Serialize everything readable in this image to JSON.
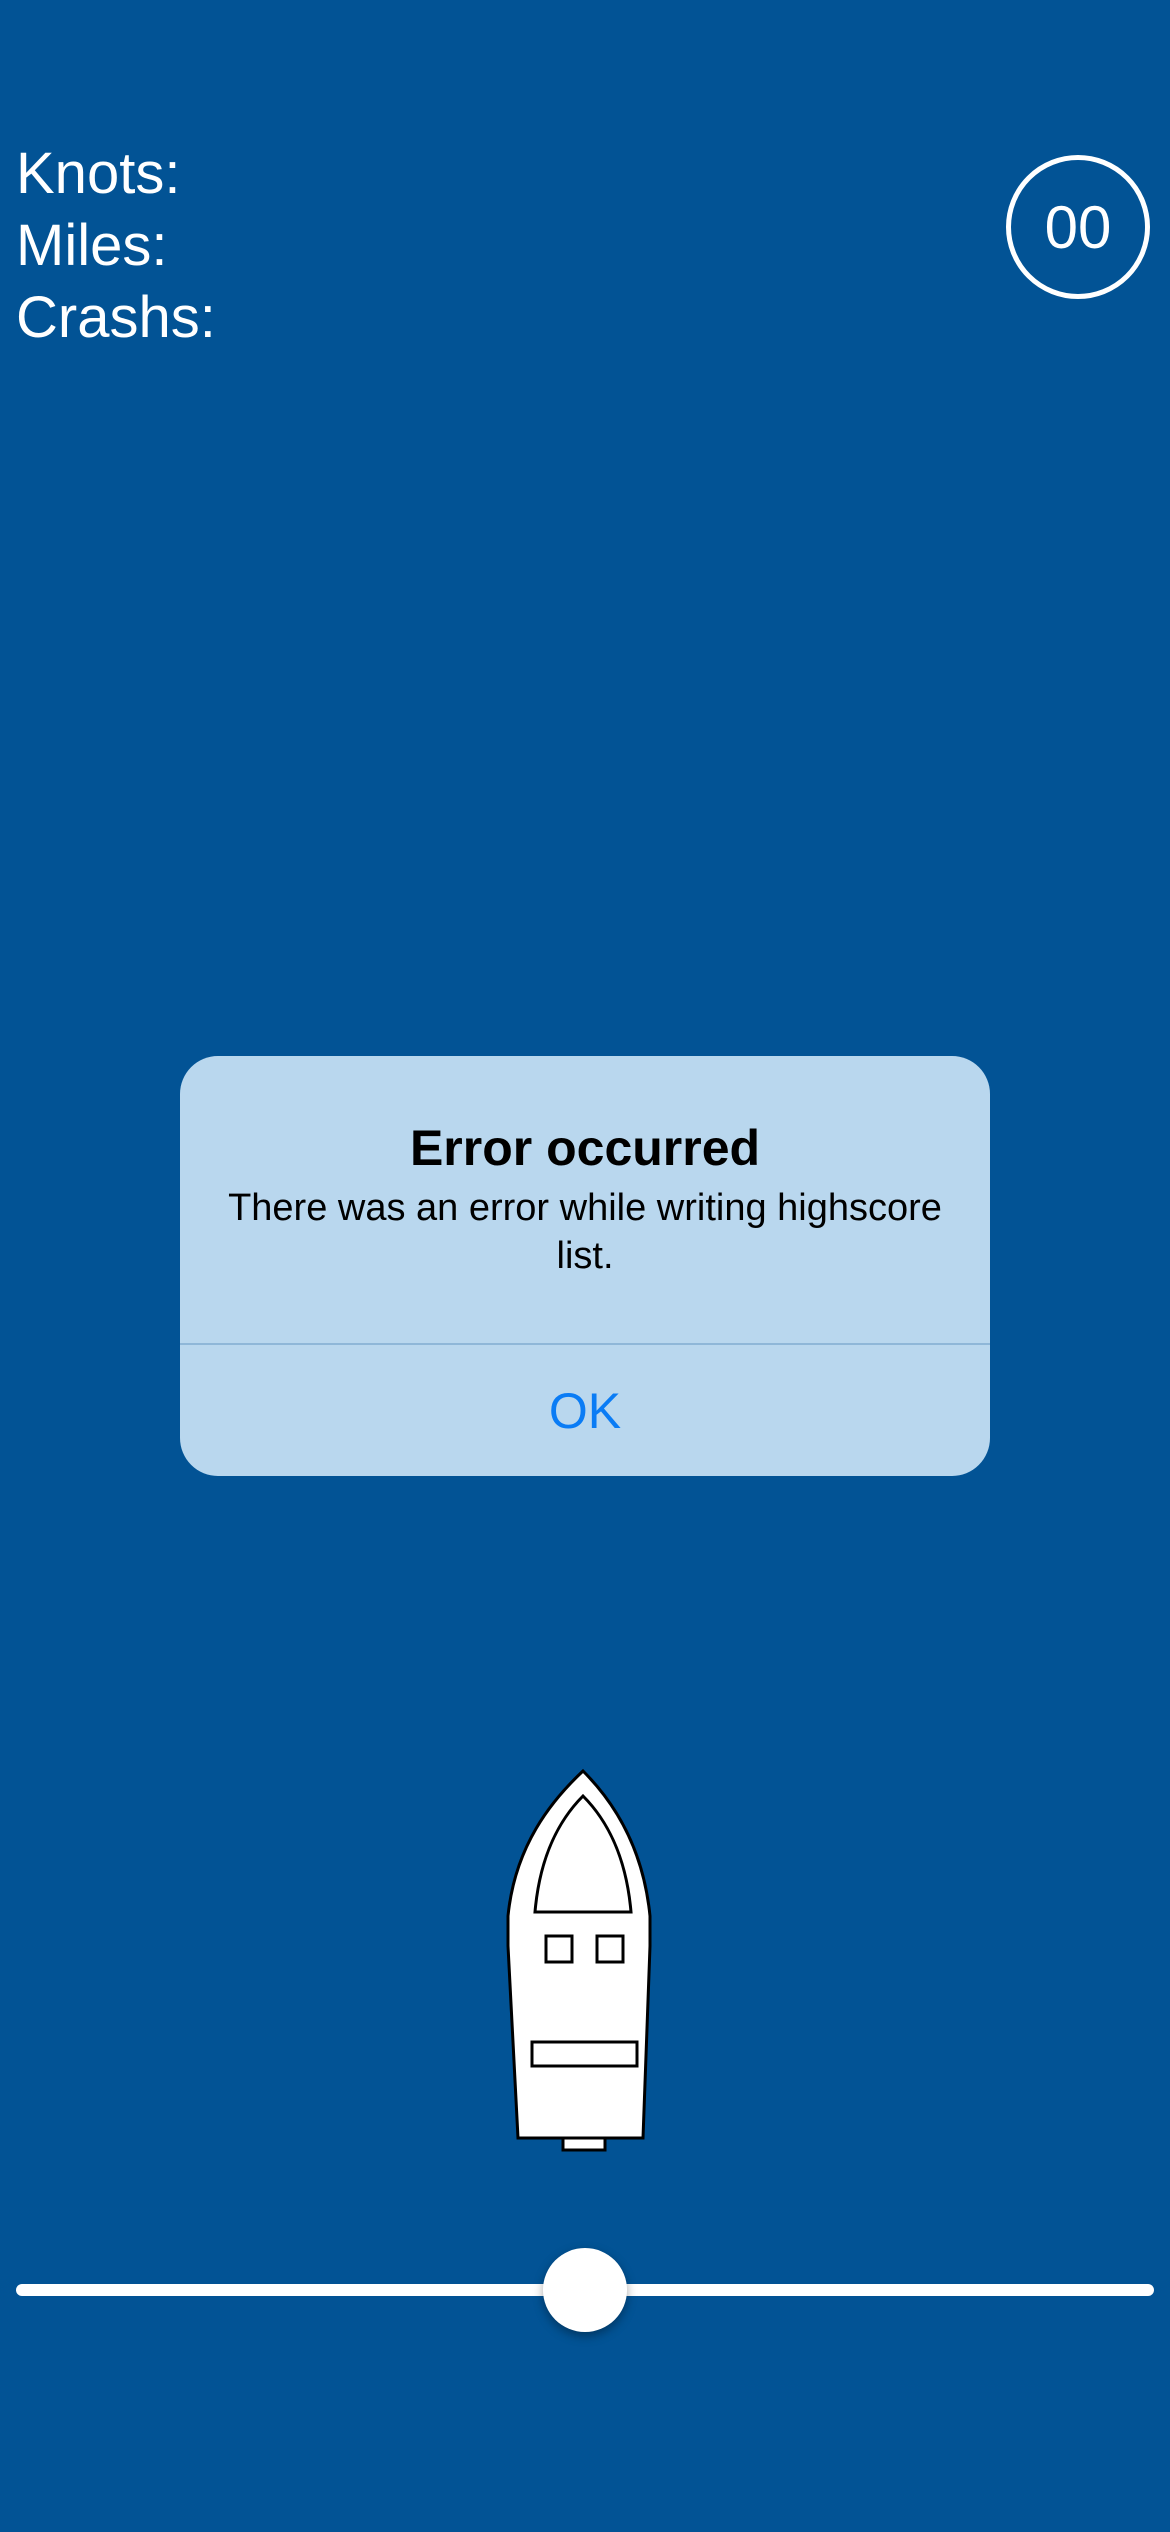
{
  "hud": {
    "knots_label": "Knots:",
    "miles_label": "Miles:",
    "crashes_label": "Crashs:",
    "timer_value": "00"
  },
  "alert": {
    "title": "Error occurred",
    "message": "There was an error while writing highscore list.",
    "ok_label": "OK"
  },
  "steering_slider": {
    "value_fraction": 0.5
  },
  "colors": {
    "water": "#025395",
    "alert_background": "#b9d7ee",
    "alert_button": "#0a7cf5"
  },
  "icons": {
    "boat": "speedboat-icon"
  }
}
